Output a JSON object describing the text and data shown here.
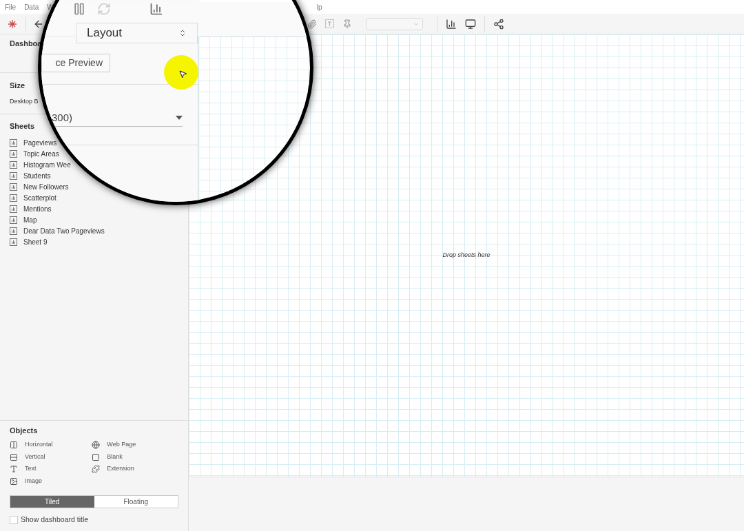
{
  "menu": [
    "File",
    "Data",
    "W",
    "lp"
  ],
  "sidebar": {
    "tab": "Dashboa",
    "size_label": "Size",
    "size_value": "Desktop B",
    "sheets_label": "Sheets",
    "sheets": [
      "Pageviews",
      "Topic Areas",
      "Histogram Wee",
      "Students",
      "New Followers",
      "Scatterplot",
      "Mentions",
      "Map",
      "Dear Data Two Pageviews",
      "Sheet 9"
    ],
    "objects_label": "Objects",
    "objects": [
      {
        "kind": "horizontal",
        "label": "Horizontal"
      },
      {
        "kind": "vertical",
        "label": "Vertical"
      },
      {
        "kind": "text",
        "label": "Text"
      },
      {
        "kind": "image",
        "label": "Image"
      },
      {
        "kind": "webpage",
        "label": "Web Page"
      },
      {
        "kind": "blank",
        "label": "Blank"
      },
      {
        "kind": "extension",
        "label": "Extension"
      }
    ],
    "layout_modes": [
      {
        "label": "Tiled",
        "selected": true
      },
      {
        "label": "Floating",
        "selected": false
      }
    ],
    "show_title": {
      "label": "Show dashboard title",
      "checked": false
    }
  },
  "canvas": {
    "hint": "Drop sheets here"
  },
  "magnifier": {
    "dropdown": "Layout",
    "button": "ce Preview",
    "size_value": "300)"
  }
}
